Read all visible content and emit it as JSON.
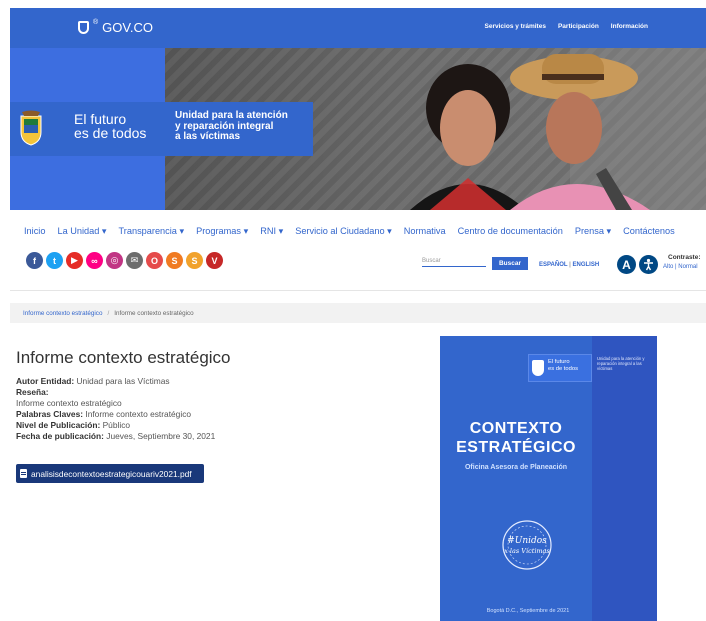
{
  "gov_bar": {
    "logo_text": "GOV.CO",
    "logo_sup": "®",
    "links": [
      "Servicios y trámites",
      "Participación",
      "Información"
    ]
  },
  "banner": {
    "brand_line1": "El futuro",
    "brand_line2": "es de todos",
    "unidad_line1": "Unidad para la atención",
    "unidad_line2": "y reparación integral",
    "unidad_line3": "a las víctimas"
  },
  "nav": {
    "items": [
      "Inicio",
      "La Unidad ▾",
      "Transparencia ▾",
      "Programas ▾",
      "RNI ▾",
      "Servicio al Ciudadano ▾",
      "Normativa",
      "Centro de documentación",
      "Prensa ▾",
      "Contáctenos"
    ]
  },
  "social": {
    "icons": [
      {
        "name": "facebook-icon",
        "glyph": "f",
        "color": "#3b5998"
      },
      {
        "name": "twitter-icon",
        "glyph": "t",
        "color": "#1da1f2"
      },
      {
        "name": "youtube-icon",
        "glyph": "▶",
        "color": "#e52d27"
      },
      {
        "name": "flickr-icon",
        "glyph": "∞",
        "color": "#ff0084"
      },
      {
        "name": "instagram-icon",
        "glyph": "◎",
        "color": "#c13584"
      },
      {
        "name": "mail-icon",
        "glyph": "✉",
        "color": "#6d6d6d"
      },
      {
        "name": "o-icon",
        "glyph": "O",
        "color": "#e54b4b"
      },
      {
        "name": "s-icon",
        "glyph": "S",
        "color": "#f07b22"
      },
      {
        "name": "s2-icon",
        "glyph": "S",
        "color": "#f1a22c"
      },
      {
        "name": "v-icon",
        "glyph": "V",
        "color": "#c62828"
      }
    ]
  },
  "search": {
    "placeholder": "Buscar",
    "button": "Buscar"
  },
  "language": {
    "espanol": "ESPAÑOL",
    "separator": "|",
    "english": "ENGLISH"
  },
  "accessibility": {
    "a_label": "A",
    "contrast_label": "Contraste:",
    "contrast_options": "Alto | Normal"
  },
  "breadcrumb": {
    "items": [
      "Informe contexto estratégico",
      "Informe contexto estratégico"
    ],
    "separator": "/"
  },
  "document": {
    "title": "Informe contexto estratégico",
    "autor_label": "Autor Entidad:",
    "autor_value": "Unidad para las Víctimas",
    "resena_label": "Reseña:",
    "resena_value": "Informe contexto estratégico",
    "palabras_label": "Palabras Claves:",
    "palabras_value": "Informe contexto estratégico",
    "nivel_label": "Nivel de Publicación:",
    "nivel_value": "Público",
    "fecha_label": "Fecha de publicación:",
    "fecha_value": "Jueves, Septiembre 30, 2021",
    "file_name": "analisisdecontextoestrategicouariv2021.pdf"
  },
  "cover": {
    "brand_line1": "El futuro",
    "brand_line2": "es de todos",
    "unidad_text": "Unidad para la atención y reparación integral a las víctimas",
    "title_line1": "CONTEXTO",
    "title_line2": "ESTRATÉGICO",
    "subtitle": "Oficina Asesora de Planeación",
    "seal_top": "#Unidos",
    "seal_bottom": "x las Víctimas",
    "footer": "Bogotá D.C., Septiembre de 2021"
  },
  "colors": {
    "gov_blue": "#3366cc",
    "dark_blue": "#19387a",
    "access_navy": "#004884"
  }
}
